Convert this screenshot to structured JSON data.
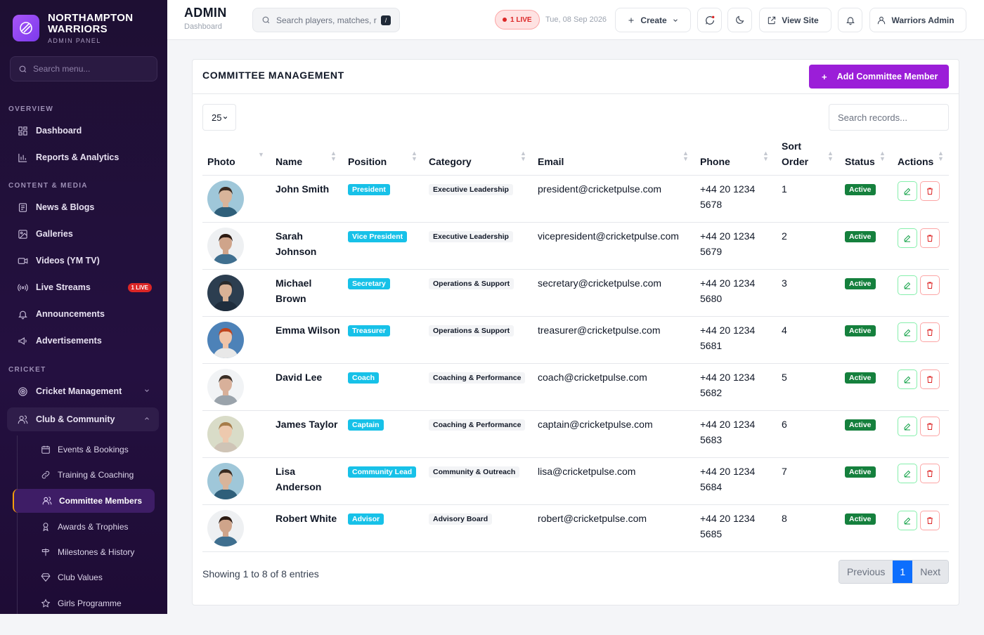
{
  "brand": {
    "name_line1": "NORTHAMPTON",
    "name_line2": "WARRIORS",
    "sub": "ADMIN PANEL"
  },
  "sidebar": {
    "search_placeholder": "Search menu...",
    "sections": {
      "overview": "OVERVIEW",
      "content": "CONTENT & MEDIA",
      "cricket": "CRICKET"
    },
    "items": {
      "dashboard": "Dashboard",
      "reports": "Reports & Analytics",
      "news": "News & Blogs",
      "galleries": "Galleries",
      "videos": "Videos (YM TV)",
      "streams": "Live Streams",
      "streams_badge": "1 LIVE",
      "announcements": "Announcements",
      "ads": "Advertisements",
      "cricket_mgmt": "Cricket Management",
      "club": "Club & Community"
    },
    "sub_items": {
      "events": "Events & Bookings",
      "training": "Training & Coaching",
      "committee": "Committee Members",
      "awards": "Awards & Trophies",
      "milestones": "Milestones & History",
      "values": "Club Values",
      "girls": "Girls Programme"
    }
  },
  "topbar": {
    "title": "ADMIN",
    "subtitle": "Dashboard",
    "search_placeholder": "Search players, matches, r",
    "kbd": "/",
    "live": "1 LIVE",
    "date": "Tue, 08 Sep 2026",
    "create": "Create",
    "view_site": "View Site",
    "user": "Warriors Admin"
  },
  "card": {
    "title": "COMMITTEE MANAGEMENT",
    "add_button": "Add Committee Member",
    "page_length": "25",
    "search_placeholder": "Search records...",
    "columns": {
      "photo": "Photo",
      "name": "Name",
      "position": "Position",
      "category": "Category",
      "email": "Email",
      "phone": "Phone",
      "sort_l1": "Sort",
      "sort_l2": "Order",
      "status": "Status",
      "actions": "Actions"
    },
    "rows": [
      {
        "name": "John Smith",
        "position": "President",
        "category": "Executive Leadership",
        "email": "president@cricketpulse.com",
        "phone1": "+44 20 1234",
        "phone2": "5678",
        "order": "1",
        "status": "Active"
      },
      {
        "name": "Sarah Johnson",
        "position": "Vice President",
        "category": "Executive Leadership",
        "email": "vicepresident@cricketpulse.com",
        "phone1": "+44 20 1234",
        "phone2": "5679",
        "order": "2",
        "status": "Active"
      },
      {
        "name": "Michael Brown",
        "position": "Secretary",
        "category": "Operations & Support",
        "email": "secretary@cricketpulse.com",
        "phone1": "+44 20 1234",
        "phone2": "5680",
        "order": "3",
        "status": "Active"
      },
      {
        "name": "Emma Wilson",
        "position": "Treasurer",
        "category": "Operations & Support",
        "email": "treasurer@cricketpulse.com",
        "phone1": "+44 20 1234",
        "phone2": "5681",
        "order": "4",
        "status": "Active"
      },
      {
        "name": "David Lee",
        "position": "Coach",
        "category": "Coaching & Performance",
        "email": "coach@cricketpulse.com",
        "phone1": "+44 20 1234",
        "phone2": "5682",
        "order": "5",
        "status": "Active"
      },
      {
        "name": "James Taylor",
        "position": "Captain",
        "category": "Coaching & Performance",
        "email": "captain@cricketpulse.com",
        "phone1": "+44 20 1234",
        "phone2": "5683",
        "order": "6",
        "status": "Active"
      },
      {
        "name": "Lisa Anderson",
        "position": "Community Lead",
        "category": "Community & Outreach",
        "email": "lisa@cricketpulse.com",
        "phone1": "+44 20 1234",
        "phone2": "5684",
        "order": "7",
        "status": "Active"
      },
      {
        "name": "Robert White",
        "position": "Advisor",
        "category": "Advisory Board",
        "email": "robert@cricketpulse.com",
        "phone1": "+44 20 1234",
        "phone2": "5685",
        "order": "8",
        "status": "Active"
      }
    ],
    "footer_info": "Showing 1 to 8 of 8 entries",
    "pager": {
      "prev": "Previous",
      "current": "1",
      "next": "Next"
    }
  },
  "colors": {
    "accent": "#9b1ed8",
    "position_badge": "#17c1e8",
    "status_active": "#15803d",
    "live": "#dc2626",
    "page_current": "#0d6efd"
  }
}
